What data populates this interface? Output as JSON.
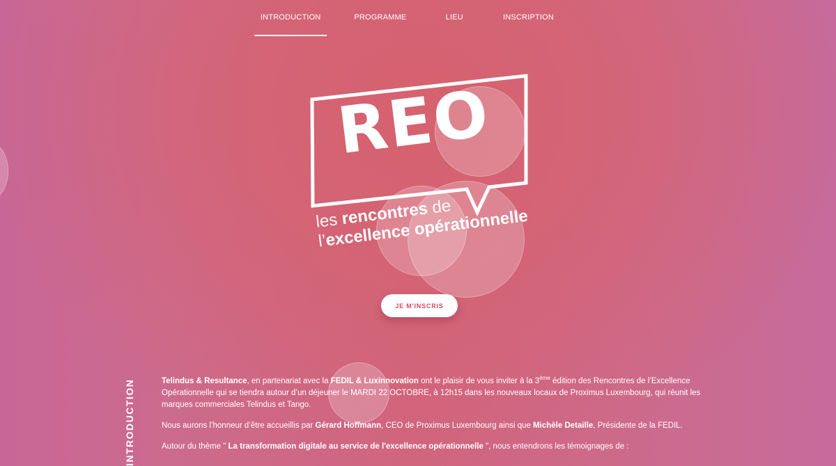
{
  "nav": {
    "items": [
      {
        "label": "INTRODUCTION",
        "active": true
      },
      {
        "label": "PROGRAMME",
        "active": false
      },
      {
        "label": "LIEU",
        "active": false
      },
      {
        "label": "INSCRIPTION",
        "active": false
      }
    ]
  },
  "hero": {
    "logo_word": "REO",
    "tagline_line1_light": "les ",
    "tagline_line1_bold": "rencontres",
    "tagline_line1_light2": " de",
    "tagline_line2_light": "l’",
    "tagline_line2_bold": "excellence opérationnelle",
    "cta_label": "JE M'INSCRIS"
  },
  "intro": {
    "section_title": "Introduction",
    "p1": {
      "org1": "Telindus & Resultance",
      "t1": ", en partenariat avec la ",
      "org2": "FEDIL & Luxinnovation",
      "t2": " ont le plaisir de vous inviter à la 3",
      "sup": "ème",
      "t3": " édition des Rencontres de l’Excellence Opérationnelle qui se tiendra autour d’un déjeuner le MARDI 22 OCTOBRE, à 12h15 dans les nouveaux locaux de Proximus Luxembourg, qui réunit les marques commerciales Telindus et Tango."
    },
    "p2": {
      "t1": "Nous aurons l’honneur d’être accueillis par ",
      "name1": "Gérard Hoffmann",
      "t2": ", CEO de Proximus Luxembourg ainsi que ",
      "name2": "Michèle Detaille",
      "t3": ", Présidente de la FEDIL."
    },
    "p3": {
      "t1": "Autour du thème \" ",
      "theme": "La transformation digitale au service de l'excellence opérationnelle",
      "t2": " \", nous entendrons les témoignages de :"
    }
  },
  "colors": {
    "background_center": "#d6626f",
    "background_edge": "#c86796",
    "cta_text": "#d9495e",
    "text": "#ffffff"
  }
}
